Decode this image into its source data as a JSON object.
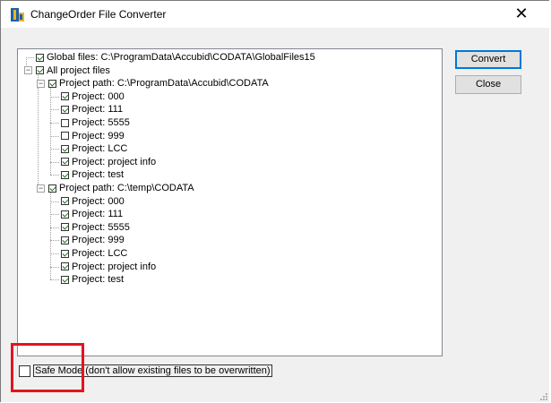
{
  "window": {
    "title": "ChangeOrder File Converter",
    "close_glyph": "✕",
    "app_icon": "accubid-app-icon"
  },
  "buttons": {
    "convert": "Convert",
    "close": "Close"
  },
  "tree": {
    "global": {
      "label": "Global files: C:\\ProgramData\\Accubid\\CODATA\\GlobalFiles15",
      "checked": true
    },
    "all_projects": {
      "label": "All project files",
      "checked": true
    },
    "paths": [
      {
        "label": "Project path: C:\\ProgramData\\Accubid\\CODATA",
        "checked": true,
        "projects": [
          {
            "label": "Project: 000",
            "checked": true
          },
          {
            "label": "Project: 111",
            "checked": true
          },
          {
            "label": "Project: 5555",
            "checked": false
          },
          {
            "label": "Project: 999",
            "checked": false
          },
          {
            "label": "Project: LCC",
            "checked": true
          },
          {
            "label": "Project: project info",
            "checked": true
          },
          {
            "label": "Project: test",
            "checked": true
          }
        ]
      },
      {
        "label": "Project path: C:\\temp\\CODATA",
        "checked": true,
        "projects": [
          {
            "label": "Project: 000",
            "checked": true
          },
          {
            "label": "Project: 111",
            "checked": true
          },
          {
            "label": "Project: 5555",
            "checked": true
          },
          {
            "label": "Project: 999",
            "checked": true
          },
          {
            "label": "Project: LCC",
            "checked": true
          },
          {
            "label": "Project: project info",
            "checked": true
          },
          {
            "label": "Project: test",
            "checked": true
          }
        ]
      }
    ]
  },
  "safe_mode": {
    "label": "Safe Mode (don't allow existing files to be overwritten)",
    "checked": false
  },
  "colors": {
    "highlight": "#e3141c",
    "check": "#1e6f1e",
    "default_button_border": "#0078d7"
  }
}
